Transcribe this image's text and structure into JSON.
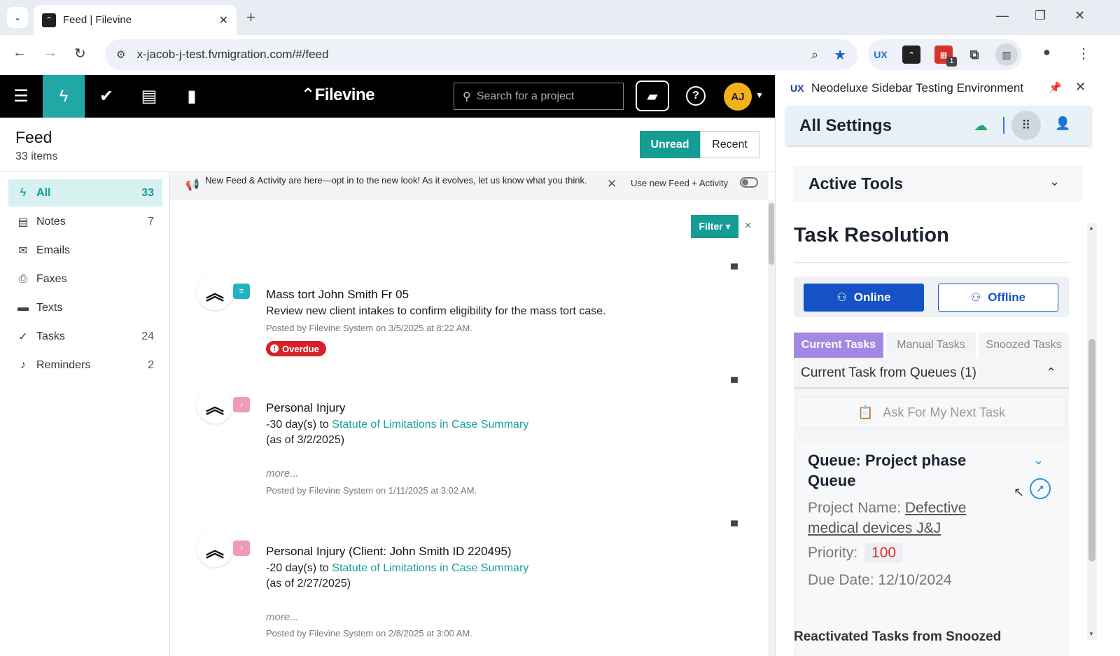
{
  "browser": {
    "tab_title": "Feed | Filevine",
    "url": "x-jacob-j-test.fvmigration.com/#/feed",
    "new_tab": "+",
    "window_controls": [
      "minimize",
      "restore",
      "close"
    ],
    "extensions": [
      "ux-extension",
      "filevine-extension",
      "calendar-extension",
      "puzzle-extension",
      "sidepanel"
    ],
    "extension_badge": "1",
    "ux_label": "UX"
  },
  "app": {
    "logo": "Filevine",
    "search_placeholder": "Search for a project",
    "avatar_initials": "AJ",
    "colors": {
      "accent": "#159d93",
      "topbar": "#000000",
      "overdue": "#d6222b"
    }
  },
  "feed": {
    "title": "Feed",
    "count": "33 items",
    "unread_label": "Unread",
    "recent_label": "Recent",
    "banner_text": "New Feed & Activity are here—opt in to the new look! As it evolves, let us know what you think.",
    "banner_toggle_label": "Use new Feed + Activity",
    "filter_label": "Filter ▾",
    "filter_close": "×"
  },
  "leftnav": {
    "items": [
      {
        "label": "All",
        "count": "33",
        "icon": "bolt-icon"
      },
      {
        "label": "Notes",
        "count": "7",
        "icon": "note-icon"
      },
      {
        "label": "Emails",
        "count": "",
        "icon": "email-icon"
      },
      {
        "label": "Faxes",
        "count": "",
        "icon": "fax-icon"
      },
      {
        "label": "Texts",
        "count": "",
        "icon": "text-icon"
      },
      {
        "label": "Tasks",
        "count": "24",
        "icon": "task-check-icon"
      },
      {
        "label": "Reminders",
        "count": "2",
        "icon": "bell-icon"
      }
    ]
  },
  "feed_items": [
    {
      "title": "Mass tort John Smith Fr 05",
      "body": "Review new client intakes to confirm eligibility for the mass tort case.",
      "meta": "Posted by Filevine System on 3/5/2025 at 8:22 AM.",
      "tag": "Overdue"
    },
    {
      "title": "Personal Injury",
      "days": "-30 day(s) to ",
      "link": "Statute of Limitations in Case Summary",
      "asof": "(as of 3/2/2025)",
      "more": "more...",
      "meta": "Posted by Filevine System on 1/11/2025 at 3:02 AM."
    },
    {
      "title": "Personal Injury (Client: John Smith ID 220495)",
      "days": "-20 day(s) to ",
      "link": "Statute of Limitations in Case Summary",
      "asof": "(as of 2/27/2025)",
      "more": "more...",
      "meta": "Posted by Filevine System on 2/8/2025 at 3:00 AM."
    }
  ],
  "sidebar": {
    "ux_logo": "UX",
    "title": "Neodeluxe Sidebar Testing Environment",
    "settings_title": "All Settings",
    "active_tools": "Active Tools",
    "task_resolution": "Task Resolution",
    "online_label": "Online",
    "offline_label": "Offline",
    "tabs": [
      "Current Tasks",
      "Manual Tasks",
      "Snoozed Tasks"
    ],
    "queue_section_title": "Current Task from Queues (1)",
    "ask_next_task": "Ask For My Next Task",
    "queue_card": {
      "title": "Queue: Project phase Queue",
      "project_name_label": "Project Name: ",
      "project_name_value": "Defective medical devices J&J",
      "priority_label": "Priority: ",
      "priority_value": "100",
      "due_date_label": "Due Date: ",
      "due_date_value": "12/10/2024"
    },
    "next_section_title": "Reactivated Tasks from Snoozed"
  }
}
